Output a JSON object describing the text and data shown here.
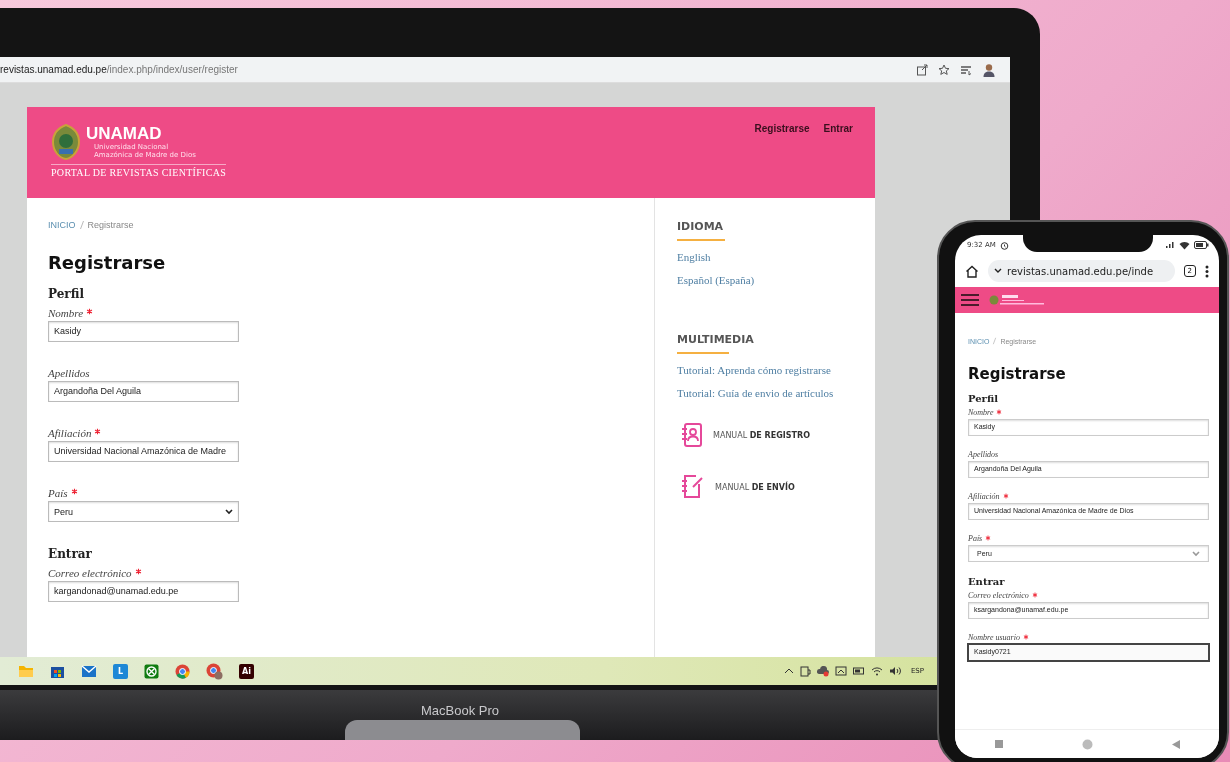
{
  "laptop": {
    "browser": {
      "url_host": "revistas.unamad.edu.pe",
      "url_path": "/index.php/index/user/register"
    },
    "site": {
      "header": {
        "title": "UNAMAD",
        "subtitle_lines": [
          "Universidad Nacional",
          "Amazónica de Madre de Dios"
        ],
        "portal": "PORTAL DE REVISTAS CIENTÍFICAS",
        "nav": [
          "Registrarse",
          "Entrar"
        ]
      },
      "breadcrumb": [
        "INICIO",
        "Registrarse"
      ],
      "heading": "Registrarse",
      "sections": [
        {
          "title": "Perfil",
          "fields": [
            {
              "label": "Nombre",
              "required": true,
              "kind": "text",
              "value": "Kasidy"
            },
            {
              "label": "Apellidos",
              "required": false,
              "kind": "text",
              "value": "Argandoña Del Aguila"
            },
            {
              "label": "Afiliación",
              "required": true,
              "kind": "text",
              "value": "Universidad Nacional Amazónica de Madre"
            },
            {
              "label": "País",
              "required": true,
              "kind": "select",
              "value": "Peru"
            }
          ]
        },
        {
          "title": "Entrar",
          "fields": [
            {
              "label": "Correo electrónico",
              "required": true,
              "kind": "text",
              "value": "kargandonad@unamad.edu.pe"
            }
          ]
        }
      ],
      "sidebar": [
        {
          "title": "IDIOMA",
          "links": [
            "English",
            "Español (España)"
          ]
        },
        {
          "title": "MULTIMEDIA",
          "links": [
            "Tutorial: Aprenda cómo registrarse",
            "Tutorial: Guía de envio de artículos"
          ],
          "manuals": [
            {
              "kind": "contacts",
              "text": "MANUAL **DE REGISTRO**"
            },
            {
              "kind": "edit",
              "text": "MANUAL **DE ENVÍO**"
            }
          ]
        }
      ]
    },
    "taskbar": {
      "apps": [
        {
          "kind": "folder"
        },
        {
          "kind": "store"
        },
        {
          "kind": "mail"
        },
        {
          "kind": "tile",
          "label": "L",
          "color": "#1e88d6"
        },
        {
          "kind": "xbox"
        },
        {
          "kind": "chrome"
        },
        {
          "kind": "chrome-profile"
        },
        {
          "kind": "tile",
          "label": "Ai",
          "color": "#330000"
        }
      ],
      "language": "ESP"
    },
    "brand": "MacBook Pro"
  },
  "phone": {
    "status_time": "9:32 AM",
    "url": "revistas.unamad.edu.pe/inde",
    "tab_count": "2",
    "breadcrumb": [
      "INICIO",
      "Registrarse"
    ],
    "heading": "Registrarse",
    "sections": [
      {
        "title": "Perfil",
        "fields": [
          {
            "label": "Nombre",
            "required": true,
            "kind": "text",
            "value": "Kasidy",
            "focused": false
          },
          {
            "label": "Apellidos",
            "required": false,
            "kind": "text",
            "value": "Argandoña Del Aguila",
            "focused": false
          },
          {
            "label": "Afiliación",
            "required": true,
            "kind": "text",
            "value": "Universidad Nacional Amazónica de Madre de Dios",
            "focused": false
          },
          {
            "label": "País",
            "required": true,
            "kind": "select",
            "value": "Peru",
            "focused": false
          }
        ]
      },
      {
        "title": "Entrar",
        "fields": [
          {
            "label": "Correo electrónico",
            "required": true,
            "kind": "text",
            "value": "ksargandona@unamaf.edu.pe",
            "focused": false
          },
          {
            "label": "Nombre usuario",
            "required": true,
            "kind": "text",
            "value": "Kasidy0721",
            "focused": true
          }
        ]
      }
    ]
  }
}
